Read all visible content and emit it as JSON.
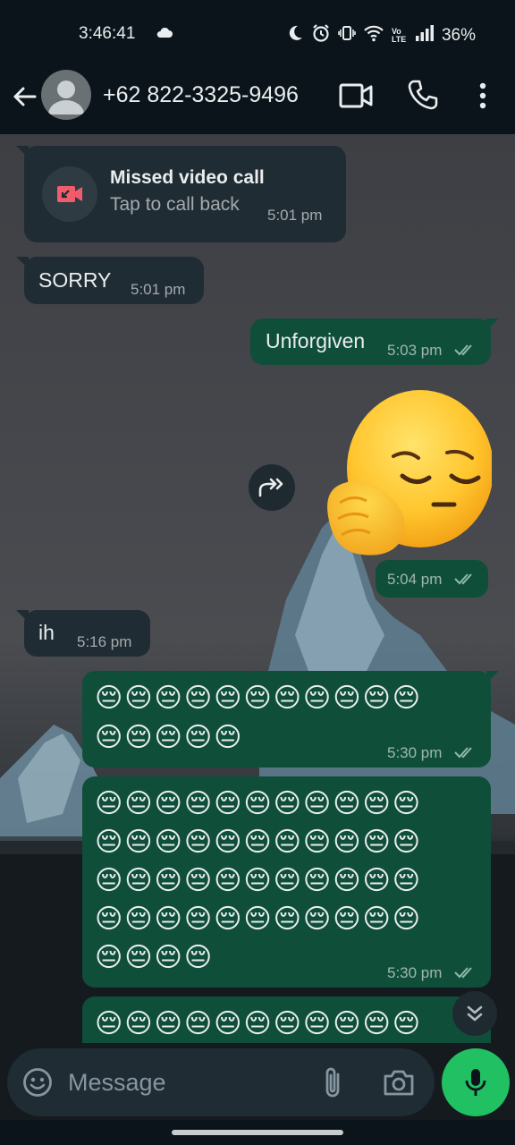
{
  "status_bar": {
    "time": "3:46:41",
    "battery": "36%",
    "network_badge": "Vo LTE"
  },
  "header": {
    "contact_name": "+62 822-3325-9496",
    "icons": [
      "back-arrow-icon",
      "avatar",
      "video-call-icon",
      "phone-icon",
      "more-vert-icon"
    ]
  },
  "messages": [
    {
      "direction": "in",
      "type": "missed_call",
      "title": "Missed video call",
      "subtitle": "Tap to call back",
      "time": "5:01 pm"
    },
    {
      "direction": "in",
      "type": "text",
      "text": "SORRY",
      "time": "5:01 pm"
    },
    {
      "direction": "out",
      "type": "text",
      "text": "Unforgiven",
      "time": "5:03 pm",
      "status": "read"
    },
    {
      "direction": "out",
      "type": "sticker",
      "sticker": "pensive-face-sticker",
      "time": "5:04 pm",
      "status": "read"
    },
    {
      "direction": "in",
      "type": "text",
      "text": "ih",
      "time": "5:16 pm"
    },
    {
      "direction": "out",
      "type": "emoji",
      "lines": [
        "😔😔😔😔😔😔😔😔😔😔😔",
        "😔😔😔😔😔"
      ],
      "time": "5:30 pm",
      "status": "read"
    },
    {
      "direction": "out",
      "type": "emoji",
      "lines": [
        "😔😔😔😔😔😔😔😔😔😔😔",
        "😔😔😔😔😔😔😔😔😔😔😔",
        "😔😔😔😔😔😔😔😔😔😔😔",
        "😔😔😔😔😔😔😔😔😔😔😔",
        "😔😔😔😔"
      ],
      "time": "5:30 pm",
      "status": "read"
    },
    {
      "direction": "out",
      "type": "emoji",
      "lines": [
        "😔😔😔😔😔😔😔😔😔😔😔"
      ],
      "time": "",
      "status": ""
    }
  ],
  "composer": {
    "placeholder": "Message"
  },
  "colors": {
    "incoming_bubble": "#202c33",
    "outgoing_bubble": "#0f4f3a",
    "mic_button": "#21c063",
    "read_ticks": "#8fb8ad",
    "missed_call_icon": "#f15c6d"
  }
}
